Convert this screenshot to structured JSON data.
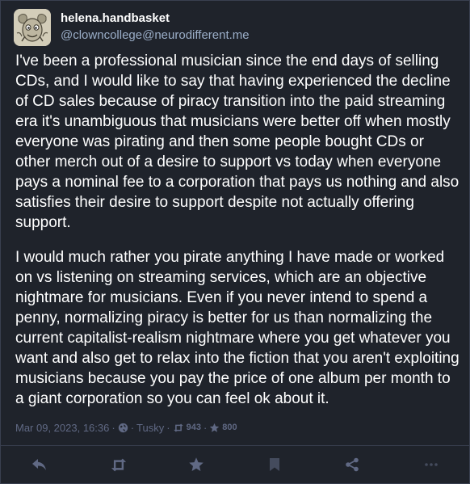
{
  "account": {
    "display_name": "helena.handbasket",
    "handle": "@clowncollege@neurodifferent.me"
  },
  "post": {
    "paragraphs": [
      "I've been a professional musician since the end days of selling CDs, and I would like to say that having experienced the decline of CD sales because of piracy transition into the paid streaming era it's unambiguous that musicians were better off when mostly everyone was pirating and then some people bought CDs or other merch out of a desire to support vs today when everyone pays a nominal fee to a corporation that pays us nothing and also satisfies their desire to support despite not actually offering support.",
      "I would much rather you pirate anything I have made or worked on vs listening on streaming services, which are an objective nightmare for musicians. Even if you never intend to spend a penny, normalizing piracy is better for us than normalizing the current capitalist-realism nightmare where you get whatever you want and also get to relax into the fiction that you aren't exploiting musicians because you pay the price of one album per month to a giant corporation so you can feel ok about it."
    ]
  },
  "meta": {
    "timestamp": "Mar 09, 2023, 16:36",
    "separator": "·",
    "visibility_icon": "globe-icon",
    "client": "Tusky",
    "boosts_icon": "retweet-icon",
    "boosts": "943",
    "favourites_icon": "star-icon",
    "favourites": "800"
  },
  "actions": [
    {
      "name": "reply-button",
      "icon": "reply-icon"
    },
    {
      "name": "boost-button",
      "icon": "retweet-icon"
    },
    {
      "name": "favourite-button",
      "icon": "star-icon"
    },
    {
      "name": "bookmark-button",
      "icon": "bookmark-icon"
    },
    {
      "name": "share-button",
      "icon": "share-icon"
    },
    {
      "name": "more-button",
      "icon": "ellipsis-icon"
    }
  ],
  "colors": {
    "background": "#1f232b",
    "text": "#ffffff",
    "secondary": "#9baec8",
    "muted": "#606984",
    "border": "#393f4f"
  }
}
